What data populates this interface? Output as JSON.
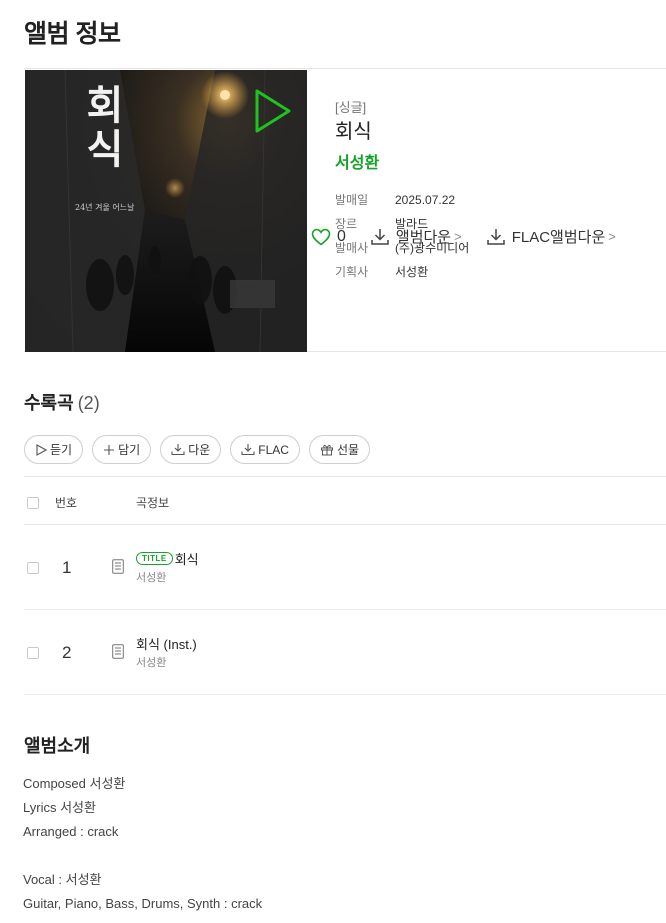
{
  "page": {
    "title": "앨범 정보"
  },
  "album": {
    "cover_title": "회식",
    "cover_subtitle": "24년 겨울 어느날",
    "type": "[싱글]",
    "name": "회식",
    "artist": "서성환",
    "info": [
      {
        "key": "발매일",
        "value": "2025.07.22"
      },
      {
        "key": "장르",
        "value": "발라드"
      },
      {
        "key": "발매사",
        "value": "(주)광수미디어"
      },
      {
        "key": "기획사",
        "value": "서성환"
      }
    ],
    "like_count": "0",
    "download_label": "앨범다운",
    "flac_download_label": "FLAC앨범다운",
    "chevron": ">"
  },
  "tracklist": {
    "title": "수록곡",
    "count": "(2)",
    "buttons": [
      {
        "label": "듣기",
        "icon": "play-icon"
      },
      {
        "label": "담기",
        "icon": "plus-icon"
      },
      {
        "label": "다운",
        "icon": "download-icon"
      },
      {
        "label": "FLAC",
        "icon": "download-icon"
      },
      {
        "label": "선물",
        "icon": "gift-icon"
      }
    ],
    "headers": {
      "number": "번호",
      "info": "곡정보"
    },
    "rows": [
      {
        "number": "1",
        "badge": "TITLE",
        "title": "회식",
        "artist": "서성환"
      },
      {
        "number": "2",
        "badge": "",
        "title": "회식 (Inst.)",
        "artist": "서성환"
      }
    ]
  },
  "intro": {
    "title": "앨범소개",
    "lines": [
      "Composed 서성환",
      "Lyrics 서성환",
      "Arranged : crack",
      "",
      "Vocal : 서성환",
      "Guitar, Piano, Bass, Drums, Synth : crack"
    ]
  },
  "colors": {
    "accent": "#17a32a",
    "text": "#222222",
    "muted": "#777777",
    "border": "#e4e4e4"
  }
}
